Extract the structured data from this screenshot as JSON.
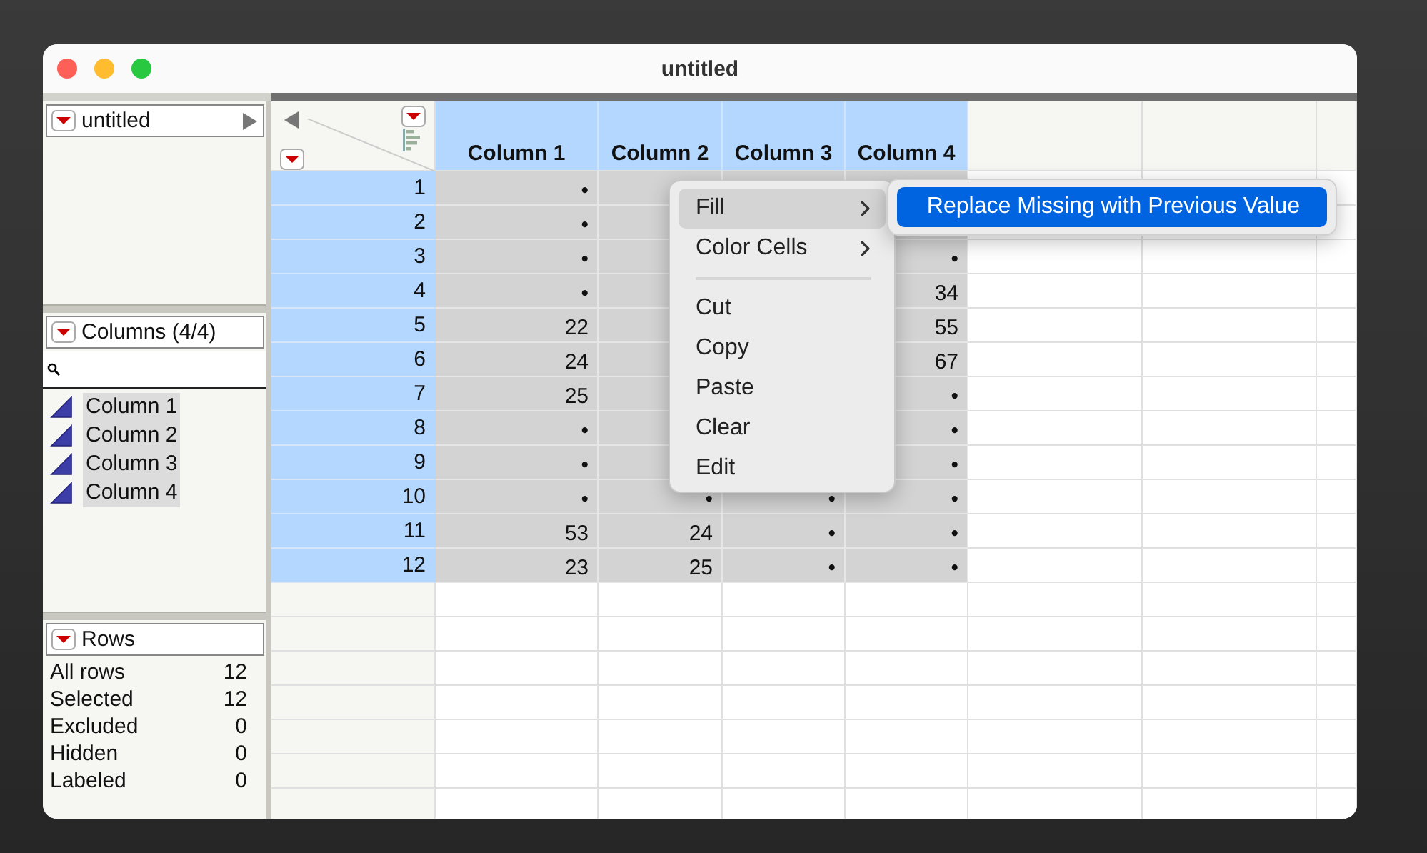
{
  "window": {
    "title": "untitled"
  },
  "table_panel": {
    "title": "untitled"
  },
  "columns_panel": {
    "title": "Columns (4/4)",
    "columns": [
      {
        "name": "Column 1",
        "selected": true
      },
      {
        "name": "Column 2",
        "selected": true
      },
      {
        "name": "Column 3",
        "selected": true
      },
      {
        "name": "Column 4",
        "selected": true
      }
    ]
  },
  "rows_panel": {
    "title": "Rows",
    "stats": [
      {
        "label": "All rows",
        "value": "12"
      },
      {
        "label": "Selected",
        "value": "12"
      },
      {
        "label": "Excluded",
        "value": "0"
      },
      {
        "label": "Hidden",
        "value": "0"
      },
      {
        "label": "Labeled",
        "value": "0"
      }
    ]
  },
  "grid": {
    "columns": [
      {
        "label": "Column 1",
        "selected": true
      },
      {
        "label": "Column 2",
        "selected": true
      },
      {
        "label": "Column 3",
        "selected": true
      },
      {
        "label": "Column 4",
        "selected": true
      }
    ],
    "rows": [
      {
        "number": "1",
        "selected": true,
        "cells": [
          "•",
          null,
          null,
          null
        ]
      },
      {
        "number": "2",
        "selected": true,
        "cells": [
          "•",
          null,
          null,
          null
        ]
      },
      {
        "number": "3",
        "selected": true,
        "cells": [
          "•",
          null,
          null,
          "•"
        ]
      },
      {
        "number": "4",
        "selected": true,
        "cells": [
          "•",
          null,
          null,
          "34"
        ]
      },
      {
        "number": "5",
        "selected": true,
        "cells": [
          "22",
          null,
          null,
          "55"
        ]
      },
      {
        "number": "6",
        "selected": true,
        "cells": [
          "24",
          null,
          null,
          "67"
        ]
      },
      {
        "number": "7",
        "selected": true,
        "cells": [
          "25",
          null,
          null,
          "•"
        ]
      },
      {
        "number": "8",
        "selected": true,
        "cells": [
          "•",
          null,
          null,
          "•"
        ]
      },
      {
        "number": "9",
        "selected": true,
        "cells": [
          "•",
          null,
          null,
          "•"
        ]
      },
      {
        "number": "10",
        "selected": true,
        "cells": [
          "•",
          "•",
          "•",
          "•"
        ]
      },
      {
        "number": "11",
        "selected": true,
        "cells": [
          "53",
          "24",
          "•",
          "•"
        ]
      },
      {
        "number": "12",
        "selected": true,
        "cells": [
          "23",
          "25",
          "•",
          "•"
        ]
      }
    ]
  },
  "context_menu": {
    "items": [
      {
        "kind": "submenu",
        "label": "Fill",
        "selected": true
      },
      {
        "kind": "submenu",
        "label": "Color Cells",
        "selected": false
      },
      {
        "kind": "separator"
      },
      {
        "kind": "action",
        "label": "Cut",
        "selected": false
      },
      {
        "kind": "action",
        "label": "Copy",
        "selected": false
      },
      {
        "kind": "action",
        "label": "Paste",
        "selected": false
      },
      {
        "kind": "action",
        "label": "Clear",
        "selected": false
      },
      {
        "kind": "action",
        "label": "Edit",
        "selected": false
      }
    ]
  },
  "submenu": {
    "items": [
      {
        "kind": "action",
        "label": "Replace Missing with Previous Value",
        "selected": true
      }
    ]
  }
}
